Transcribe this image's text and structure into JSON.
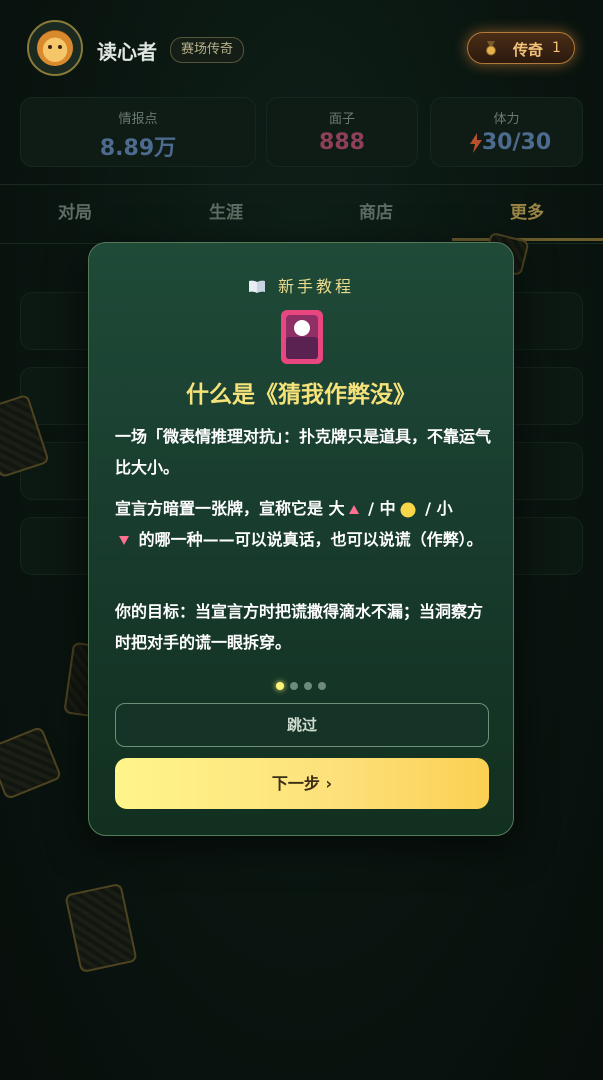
{
  "header": {
    "avatar_icon": "lion-avatar-icon",
    "nickname": "读心者",
    "rank_title": "赛场传奇",
    "badge": {
      "icon": "medal-icon",
      "label": "传奇",
      "level": "1"
    }
  },
  "stats": {
    "intel": {
      "label": "情报点",
      "value": "8.89万"
    },
    "face": {
      "label": "面子",
      "value": "888"
    },
    "energy": {
      "label": "体力",
      "value": "30/30",
      "icon": "lightning-icon"
    }
  },
  "tabs": [
    {
      "label": "对局"
    },
    {
      "label": "生涯"
    },
    {
      "label": "商店"
    },
    {
      "label": "更多"
    }
  ],
  "active_tab": "更多",
  "tutorial": {
    "header": "新手教程",
    "header_icon": "book-icon",
    "card_icon": "card-icon",
    "title": "什么是《猜我作弊没》",
    "paragraph1": "一场「微表情推理对抗」：扑克牌只是道具，不靠运气比大小。",
    "paragraph2": {
      "before": "宣言方暗置一张牌，宣称它是 大",
      "sep1": " / 中",
      "sep2": " / 小",
      "after": " 的哪一种——可以说真话，也可以说谎（作弊）。"
    },
    "paragraph3": "你的目标：当宣言方时把谎撒得滴水不漏；当洞察方时把对手的谎一眼拆穿。",
    "page_dots": {
      "count": 4,
      "current": 1
    },
    "skip_label": "跳过",
    "next_label": "下一步 ›"
  },
  "colors": {
    "accent_gold": "#f6e27a",
    "button_yellow": "#fde07a",
    "modal_green": "#1f4a38",
    "big_marker": "#ff6f91",
    "mid_marker": "#f7d64a",
    "small_marker": "#ff6f91"
  }
}
